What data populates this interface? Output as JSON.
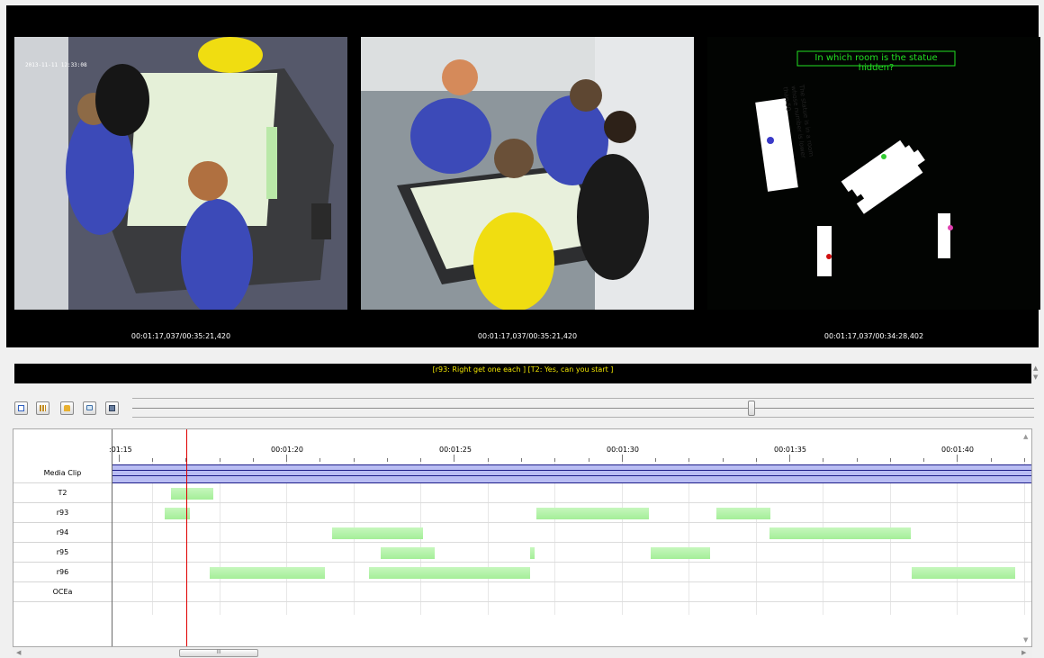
{
  "videos": [
    {
      "time": "00:01:17,037/00:35:21,420",
      "osd": "2013-11-11 12:33:08"
    },
    {
      "time": "00:01:17,037/00:35:21,420"
    },
    {
      "time": "00:01:17,037/00:34:28,402",
      "question": "In which room is the statue hidden?",
      "card_text": "The statue is in a room whose number is lower than 50"
    }
  ],
  "subtitle": "[r93: Right get one each ] [T2: Yes, can you start ]",
  "toolbar": {
    "buttons": [
      "text-icon",
      "grid-icon",
      "lock-icon",
      "comment-icon",
      "save-icon"
    ]
  },
  "timeline": {
    "ruler_labels": [
      ":01:15",
      "00:01:20",
      "00:01:25",
      "00:01:30",
      "00:01:35",
      "00:01:40"
    ],
    "tiers": [
      {
        "name": "Media Clip"
      },
      {
        "name": "T2"
      },
      {
        "name": "r93"
      },
      {
        "name": "r94"
      },
      {
        "name": "r95"
      },
      {
        "name": "r96"
      },
      {
        "name": "OCEa"
      }
    ]
  },
  "scrollbar": {
    "thumb_label": "III"
  }
}
